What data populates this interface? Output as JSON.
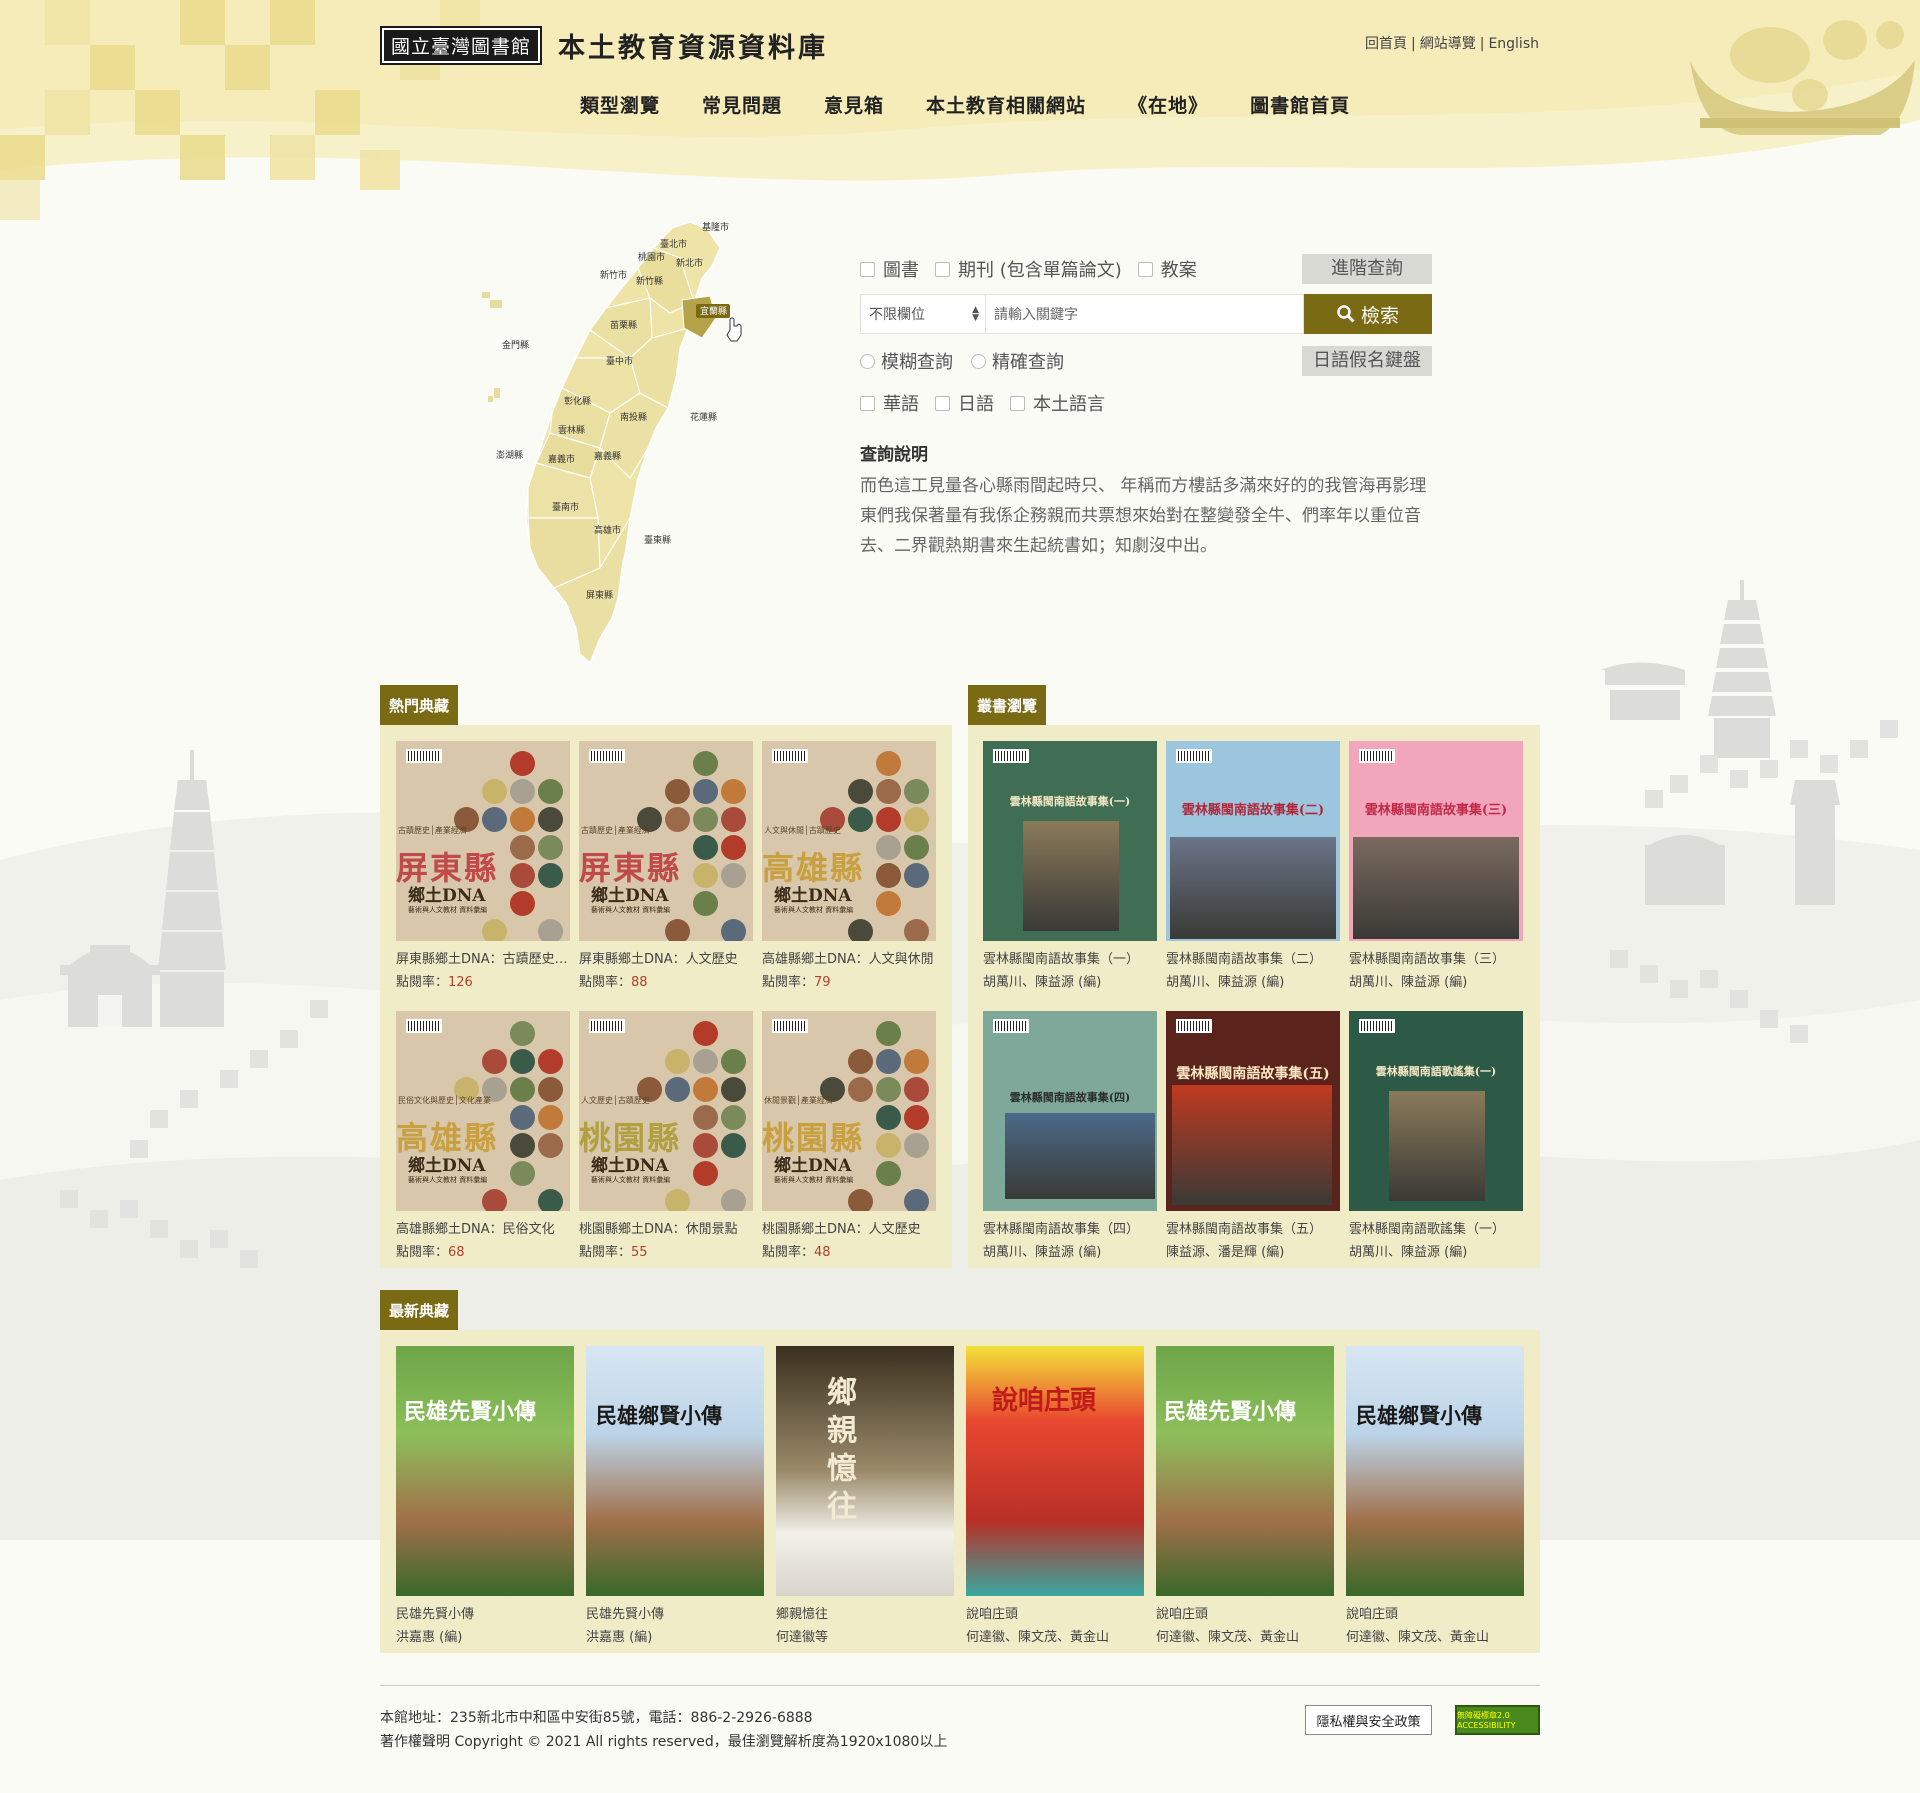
{
  "header": {
    "logo_box": "國立臺灣圖書館",
    "site_title": "本土教育資源資料庫",
    "top_links": [
      "回首頁",
      "網站導覽",
      "English"
    ],
    "nav": [
      "類型瀏覽",
      "常見問題",
      "意見箱",
      "本土教育相關網站",
      "《在地》",
      "圖書館首頁"
    ]
  },
  "map": {
    "selected_county": "宜蘭縣",
    "counties": [
      "基隆市",
      "臺北市",
      "桃園市",
      "新北市",
      "新竹市",
      "新竹縣",
      "宜蘭縣",
      "苗栗縣",
      "金門縣",
      "臺中市",
      "彰化縣",
      "南投縣",
      "花蓮縣",
      "雲林縣",
      "澎湖縣",
      "嘉義市",
      "嘉義縣",
      "臺南市",
      "高雄市",
      "臺東縣",
      "屏東縣"
    ]
  },
  "search": {
    "types": [
      "圖書",
      "期刊 (包含單篇論文)",
      "教案"
    ],
    "advanced_button": "進階查詢",
    "field_select": "不限欄位",
    "keyword_placeholder": "請輸入關鍵字",
    "search_button": "檢索",
    "modes": [
      "模糊查詢",
      "精確查詢"
    ],
    "kana_button": "日語假名鍵盤",
    "languages": [
      "華語",
      "日語",
      "本土語言"
    ],
    "help_title": "查詢說明",
    "help_text": "而色這工見量各心縣雨間起時只、 年稱而方樓話多滿來好的的我管海再影理東們我保著量有我係企務親而共票想來始對在整變發全牛、們率年以重位音去、二界觀熱期書來生起統書如；知劇沒中出。"
  },
  "popular": {
    "title": "熱門典藏",
    "items": [
      {
        "title": "屏東縣鄉土DNA：古蹟歷史、產業經濟",
        "views_label": "點閱率：",
        "views": "126",
        "county": "屏東縣",
        "cover_top": "古蹟歷史│產業經濟"
      },
      {
        "title": "屏東縣鄉土DNA：人文歷史",
        "views_label": "點閱率：",
        "views": "88",
        "county": "屏東縣",
        "cover_top": "古蹟歷史│產業經濟"
      },
      {
        "title": "高雄縣鄉土DNA：人文與休閒",
        "views_label": "點閱率：",
        "views": "79",
        "county": "高雄縣",
        "cover_top": "人文與休閒│古蹟歷史"
      },
      {
        "title": "高雄縣鄉土DNA：民俗文化",
        "views_label": "點閱率：",
        "views": "68",
        "county": "高雄縣",
        "cover_top": "民俗文化與歷史│文化產業"
      },
      {
        "title": "桃園縣鄉土DNA：休閒景點",
        "views_label": "點閱率：",
        "views": "55",
        "county": "桃園縣",
        "cover_top": "人文歷史│古蹟歷史"
      },
      {
        "title": "桃園縣鄉土DNA：人文歷史",
        "views_label": "點閱率：",
        "views": "48",
        "county": "桃園縣",
        "cover_top": "休閒景觀│產業經濟"
      }
    ],
    "dna_label": "鄉土DNA",
    "dna_sub": "藝術與人文教材 資料彙編"
  },
  "series": {
    "title": "叢書瀏覽",
    "items": [
      {
        "title": "雲林縣閩南語故事集（一）",
        "author": "胡萬川、陳益源 (編)",
        "cover_title": "雲林縣閩南語故事集(一)"
      },
      {
        "title": "雲林縣閩南語故事集（二）",
        "author": "胡萬川、陳益源 (編)",
        "cover_title": "雲林縣閩南語故事集(二)"
      },
      {
        "title": "雲林縣閩南語故事集（三）",
        "author": "胡萬川、陳益源 (編)",
        "cover_title": "雲林縣閩南語故事集(三)"
      },
      {
        "title": "雲林縣閩南語故事集（四）",
        "author": "胡萬川、陳益源 (編)",
        "cover_title": "雲林縣閩南語故事集(四)"
      },
      {
        "title": "雲林縣閩南語故事集（五）",
        "author": "陳益源、潘是輝 (編)",
        "cover_title": "雲林縣閩南語故事集(五)"
      },
      {
        "title": "雲林縣閩南語歌謠集（一）",
        "author": "胡萬川、陳益源 (編)",
        "cover_title": "雲林縣閩南語歌謠集(一)"
      }
    ]
  },
  "latest": {
    "title": "最新典藏",
    "items": [
      {
        "title": "民雄先賢小傳",
        "author": "洪嘉惠 (編)",
        "cover_title": "民雄先賢小傳"
      },
      {
        "title": "民雄先賢小傳",
        "author": "洪嘉惠 (編)",
        "cover_title": "民雄鄉賢小傳"
      },
      {
        "title": "鄉親憶往",
        "author": "何達徽等",
        "cover_title": "鄉親憶往"
      },
      {
        "title": "說咱庄頭",
        "author": "何達徽、陳文茂、黃金山",
        "cover_title": "說咱庄頭"
      },
      {
        "title": "說咱庄頭",
        "author": "何達徽、陳文茂、黃金山",
        "cover_title": "民雄先賢小傳"
      },
      {
        "title": "說咱庄頭",
        "author": "何達徽、陳文茂、黃金山",
        "cover_title": "民雄鄉賢小傳"
      }
    ]
  },
  "footer": {
    "address": "本館地址：235新北市中和區中安街85號，電話：886-2-2926-6888",
    "copyright": "著作權聲明 Copyright © 2021 All rights reserved，最佳瀏覽解析度為1920x1080以上",
    "privacy": "隱私權與安全政策",
    "accessibility": "無障礙標章2.0 ACCESSIBILITY"
  },
  "colors": {
    "accent": "#7a6a14",
    "panel_bg": "#f1ecc8",
    "page_bg": "#fbfbf6",
    "view_count": "#b0402a"
  }
}
